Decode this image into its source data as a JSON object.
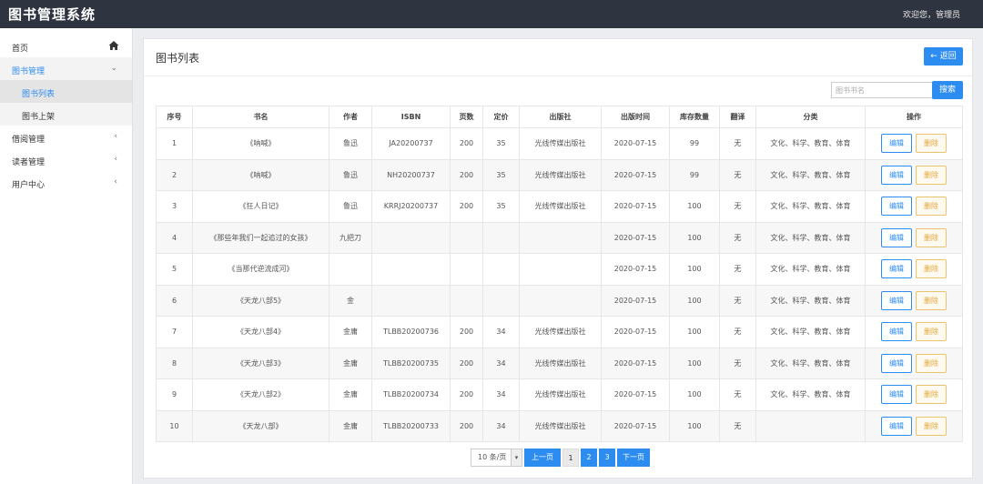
{
  "header": {
    "app_title": "图书管理系统",
    "welcome": "欢迎您，管理员"
  },
  "sidebar": {
    "items": [
      {
        "label": "首页",
        "icon": "home-icon"
      },
      {
        "label": "图书管理",
        "arrow": "⌄"
      },
      {
        "label": "图书列表"
      },
      {
        "label": "图书上架"
      },
      {
        "label": "借阅管理",
        "arrow": "‹"
      },
      {
        "label": "读者管理",
        "arrow": "‹"
      },
      {
        "label": "用户中心",
        "arrow": "‹"
      }
    ]
  },
  "panel": {
    "title": "图书列表",
    "back_label": "← 返回",
    "search_placeholder": "图书书名",
    "search_label": "搜索"
  },
  "table": {
    "headers": [
      "序号",
      "书名",
      "作者",
      "ISBN",
      "页数",
      "定价",
      "出版社",
      "出版时间",
      "库存数量",
      "翻译",
      "分类",
      "操作"
    ],
    "edit_label": "编辑",
    "delete_label": "删除",
    "rows": [
      [
        "1",
        "《呐喊》",
        "鲁迅",
        "JA20200737",
        "200",
        "35",
        "光线传媒出版社",
        "2020-07-15",
        "99",
        "无",
        "文化、科学、教育、体育"
      ],
      [
        "2",
        "《呐喊》",
        "鲁迅",
        "NH20200737",
        "200",
        "35",
        "光线传媒出版社",
        "2020-07-15",
        "99",
        "无",
        "文化、科学、教育、体育"
      ],
      [
        "3",
        "《狂人日记》",
        "鲁迅",
        "KRRJ20200737",
        "200",
        "35",
        "光线传媒出版社",
        "2020-07-15",
        "100",
        "无",
        "文化、科学、教育、体育"
      ],
      [
        "4",
        "《那些年我们一起追过的女孩》",
        "九把刀",
        "",
        "",
        "",
        "",
        "2020-07-15",
        "100",
        "无",
        "文化、科学、教育、体育"
      ],
      [
        "5",
        "《当那代逆流成河》",
        "",
        "",
        "",
        "",
        "",
        "2020-07-15",
        "100",
        "无",
        "文化、科学、教育、体育"
      ],
      [
        "6",
        "《天龙八部5》",
        "金",
        "",
        "",
        "",
        "",
        "2020-07-15",
        "100",
        "无",
        "文化、科学、教育、体育"
      ],
      [
        "7",
        "《天龙八部4》",
        "金庸",
        "TLBB20200736",
        "200",
        "34",
        "光线传媒出版社",
        "2020-07-15",
        "100",
        "无",
        "文化、科学、教育、体育"
      ],
      [
        "8",
        "《天龙八部3》",
        "金庸",
        "TLBB20200735",
        "200",
        "34",
        "光线传媒出版社",
        "2020-07-15",
        "100",
        "无",
        "文化、科学、教育、体育"
      ],
      [
        "9",
        "《天龙八部2》",
        "金庸",
        "TLBB20200734",
        "200",
        "34",
        "光线传媒出版社",
        "2020-07-15",
        "100",
        "无",
        "文化、科学、教育、体育"
      ],
      [
        "10",
        "《天龙八部》",
        "金庸",
        "TLBB20200733",
        "200",
        "34",
        "光线传媒出版社",
        "2020-07-15",
        "100",
        "无",
        ""
      ]
    ]
  },
  "pager": {
    "page_size": "10 条/页",
    "prev_label": "上一页",
    "pages": [
      "1",
      "2",
      "3"
    ],
    "next_label": "下一页"
  },
  "colors": {
    "accent": "#2d8cf0",
    "topbar": "#2f3540",
    "delete": "#e0a73a"
  }
}
